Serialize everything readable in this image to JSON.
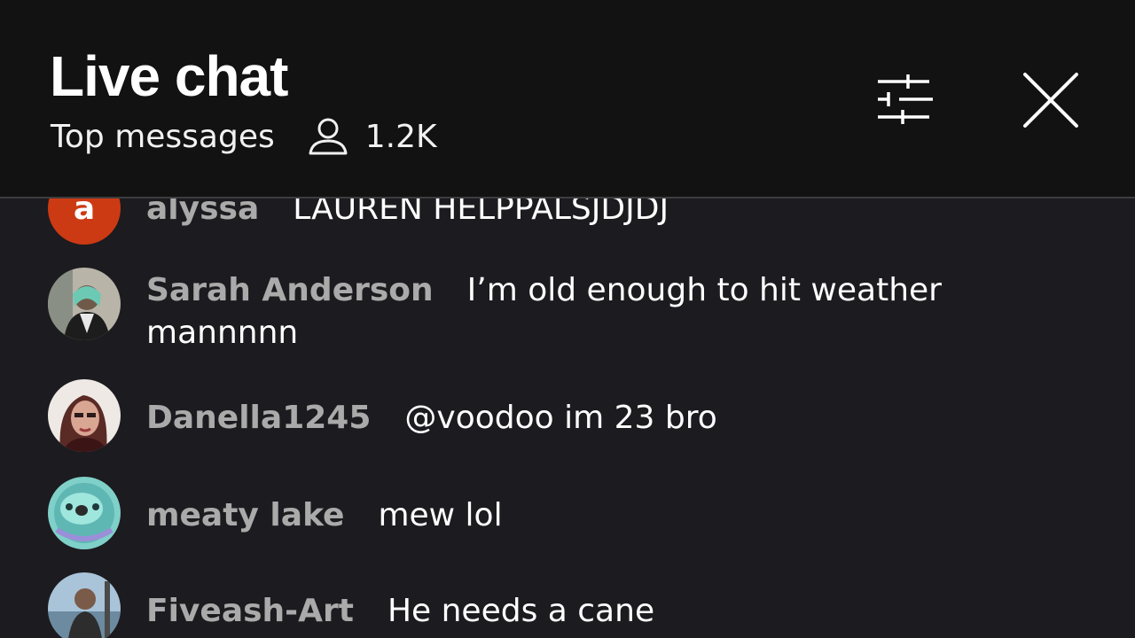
{
  "header": {
    "title": "Live chat",
    "mode": "Top messages",
    "viewer_count": "1.2K",
    "viewer_icon": "person-outline-icon",
    "filter_icon": "sliders-icon",
    "close_icon": "close-icon"
  },
  "colors": {
    "header_bg": "#121212",
    "list_bg": "#1c1b1f",
    "author_color": "#aaaaaa",
    "letter_avatar_bg": "#cc3a14"
  },
  "messages": [
    {
      "author": "alyssa",
      "text": "LAUREN HELPPALSJDJDJ",
      "avatar_letter": "a"
    },
    {
      "author": "Sarah Anderson",
      "text": "I’m old enough to hit weather mannnnn"
    },
    {
      "author": "Danella1245",
      "text": "@voodoo im 23 bro"
    },
    {
      "author": "meaty lake",
      "text": "mew lol"
    },
    {
      "author": "Fiveash-Art",
      "text": "He needs a cane"
    }
  ]
}
